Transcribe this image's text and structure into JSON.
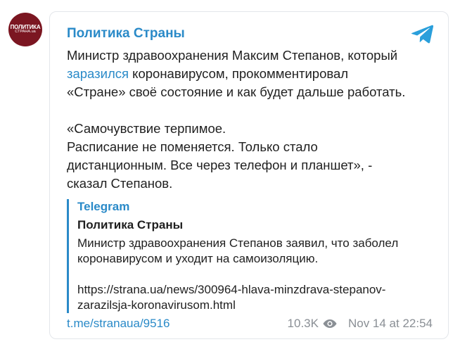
{
  "channel": {
    "name": "Политика Страны",
    "avatar_line1": "ПОЛИТИКА",
    "avatar_line2": "СТРАНА.ua",
    "avatar_color": "#7b1621"
  },
  "message": {
    "line1": "Министр здравоохранения Максим Степанов, который",
    "link_word": "заразился",
    "line2_rest": " коронавирусом, прокомментировал",
    "line3": "«Стране» своё состояние и как будет дальше работать.",
    "quote_line1": "«Самочувствие терпимое.",
    "quote_line2": "Расписание не поменяется. Только стало",
    "quote_line3": "дистанционным. Все через телефон и планшет», -",
    "quote_line4": "сказал Степанов."
  },
  "preview": {
    "source": "Telegram",
    "title": "Политика Страны",
    "text_line1": "Министр здравоохранения Степанов заявил, что заболел",
    "text_line2": "коронавирусом и уходит на самоизоляцию.",
    "url_line1": "https://strana.ua/news/300964-hlava-minzdrava-stepanov-",
    "url_line2": "zarazilsja-koronavirusom.html"
  },
  "footer": {
    "permalink": "t.me/stranaua/9516",
    "views": "10.3K",
    "timestamp": "Nov 14 at 22:54"
  },
  "icons": {
    "telegram": "telegram-logo-icon",
    "views": "eye-icon"
  },
  "colors": {
    "accent": "#2a8ac8",
    "text": "#1f1f1f",
    "muted": "#8a8f95",
    "border": "#e3e6ea"
  }
}
